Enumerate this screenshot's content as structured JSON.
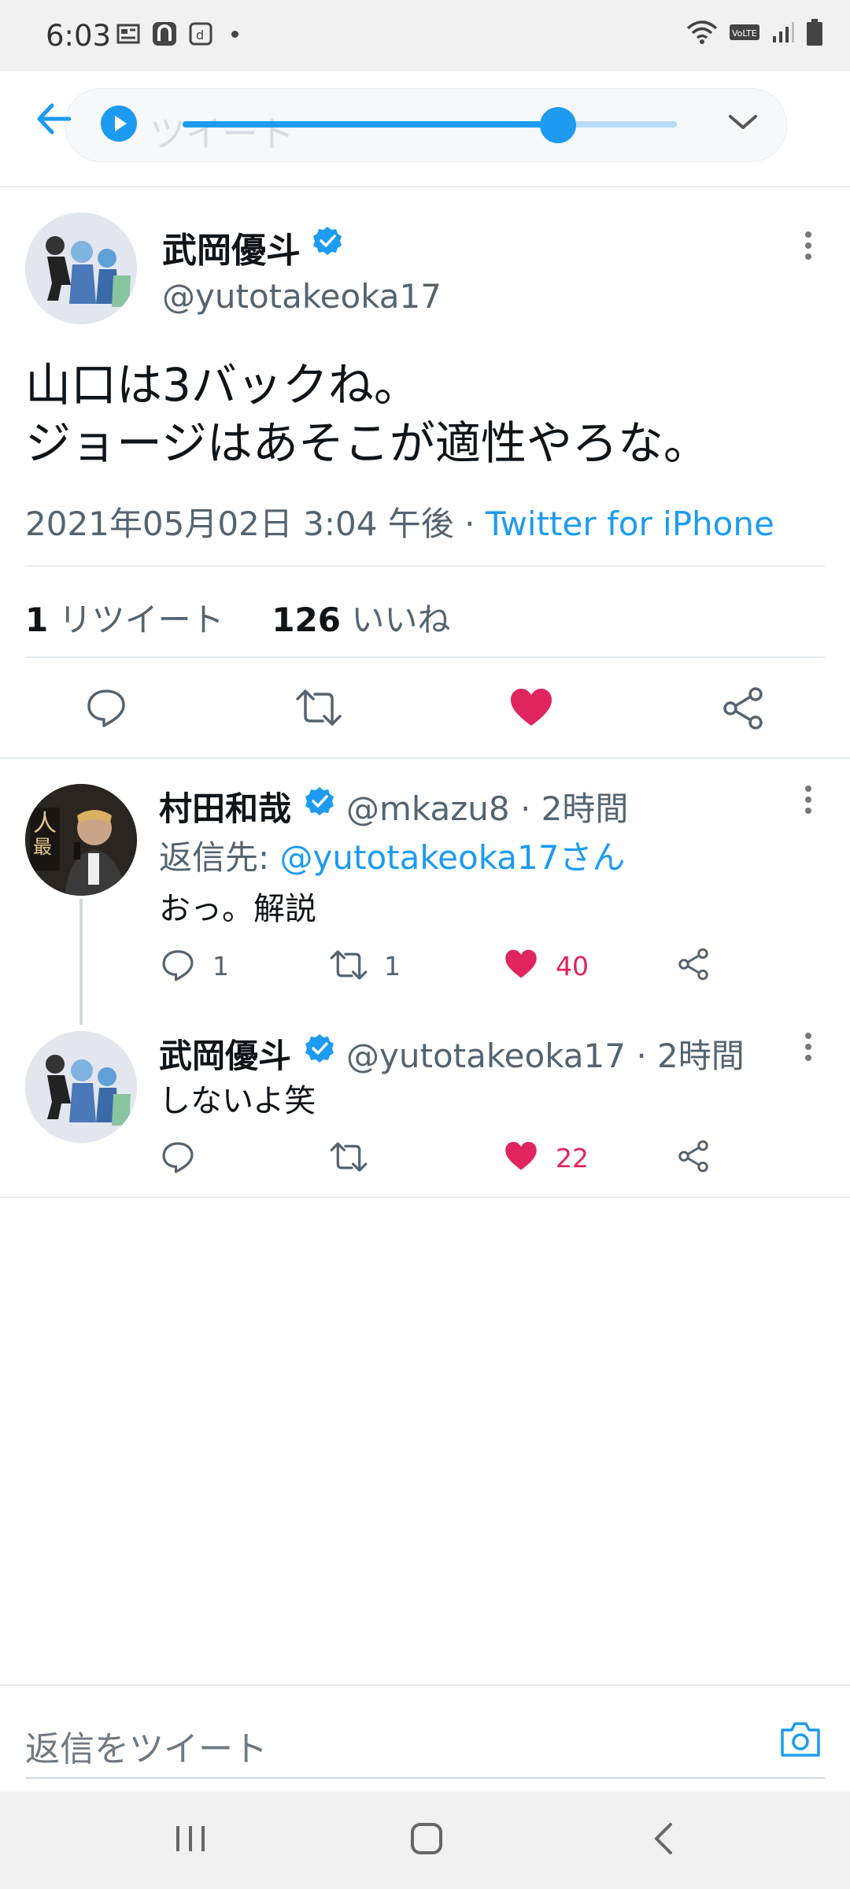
{
  "status_bar": {
    "time": "6:03"
  },
  "header": {
    "title": "ツイート"
  },
  "player": {
    "progress": 0.76
  },
  "tweet": {
    "author_name": "武岡優斗",
    "handle": "@yutotakeoka17",
    "text_line1": "山口は3バックね。",
    "text_line2": "ジョージはあそこが適性やろな。",
    "timestamp": "2021年05月02日 3:04 午後 · ",
    "source": "Twitter for iPhone",
    "retweets_count": "1",
    "retweets_label": "リツイート",
    "likes_count": "126",
    "likes_label": "いいね"
  },
  "replies": [
    {
      "author_name": "村田和哉",
      "handle": "@mkazu8 · 2時間",
      "reply_to_prefix": "返信先: ",
      "reply_to": "@yutotakeoka17さん",
      "text": "おっ。解説",
      "reply_count": "1",
      "retweet_count": "1",
      "like_count": "40"
    },
    {
      "author_name": "武岡優斗",
      "handle": "@yutotakeoka17 · 2時間",
      "text": "しないよ笑",
      "like_count": "22"
    }
  ],
  "compose": {
    "placeholder": "返信をツイート"
  },
  "colors": {
    "accent": "#1d9bf0",
    "like": "#e0245e",
    "text": "#0f1419",
    "secondary": "#536471"
  },
  "icons": [
    "back-arrow-icon",
    "play-icon",
    "chevron-down-icon",
    "verified-icon",
    "more-icon",
    "reply-icon",
    "retweet-icon",
    "heart-icon",
    "share-icon",
    "camera-icon"
  ]
}
